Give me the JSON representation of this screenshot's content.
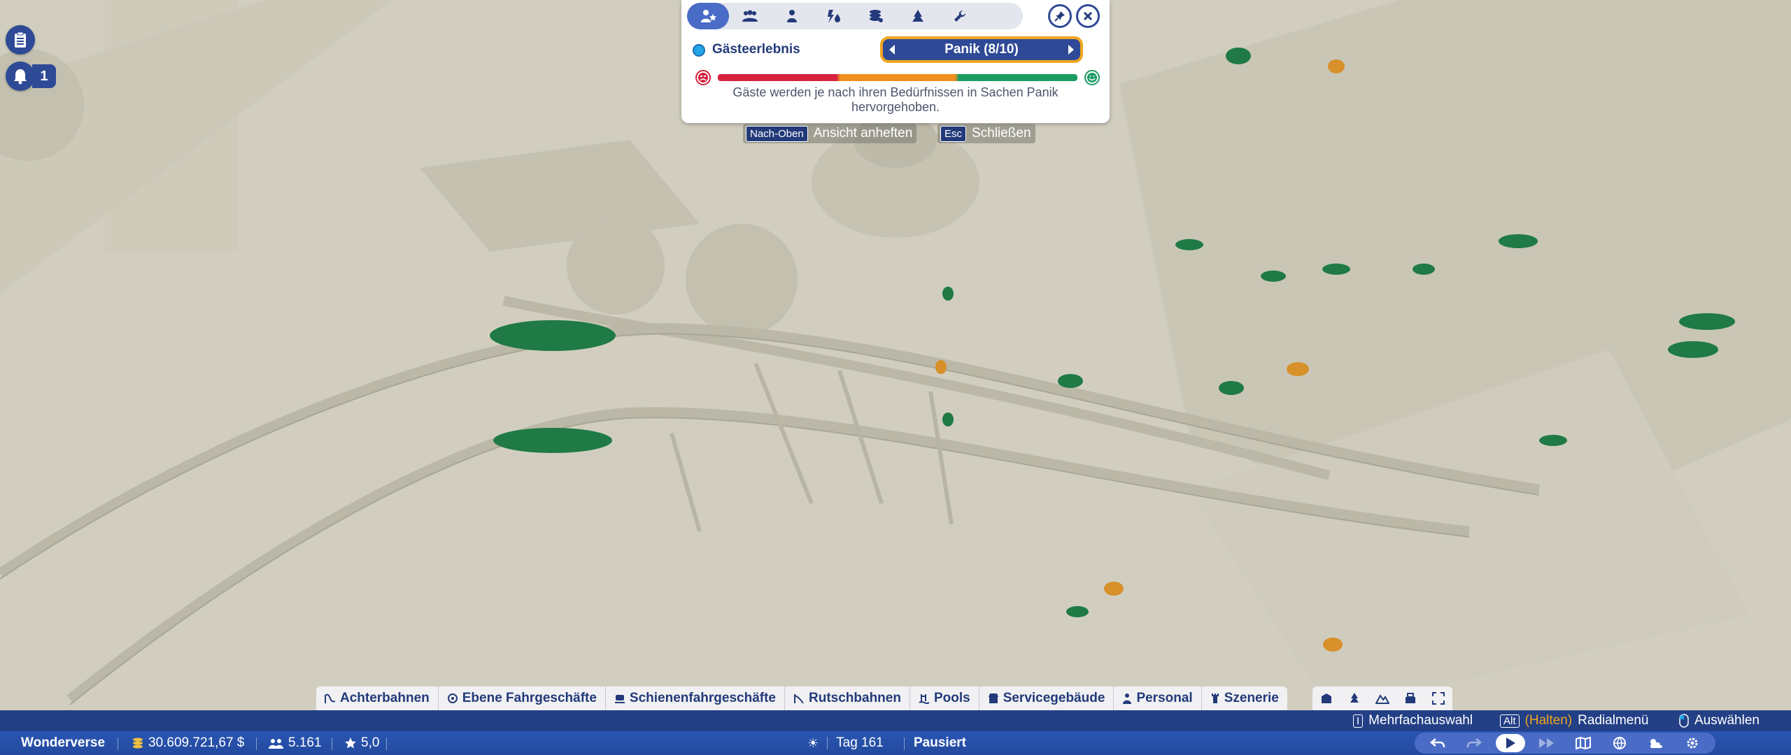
{
  "overlay": {
    "tabs": [
      {
        "name": "guest-experience",
        "icon": "guest-star-icon",
        "active": true
      },
      {
        "name": "groups",
        "icon": "group-icon",
        "active": false
      },
      {
        "name": "guest-single",
        "icon": "person-icon",
        "active": false
      },
      {
        "name": "needs",
        "icon": "drop-bolt-icon",
        "active": false
      },
      {
        "name": "money",
        "icon": "coins-icon",
        "active": false
      },
      {
        "name": "scenery",
        "icon": "tree-icon",
        "active": false
      },
      {
        "name": "maintenance",
        "icon": "wrench-icon",
        "active": false
      }
    ],
    "legend_title": "Gästeerlebnis",
    "selector_value": "Panik (8/10)",
    "description": "Gäste werden je nach ihren Bedürfnissen in Sachen Panik hervorgehoben.",
    "colors": {
      "bad": "#d5233f",
      "mid": "#f08e1e",
      "good": "#1b9b62",
      "accent": "#f0a520"
    }
  },
  "key_hints": {
    "pin_key": "Nach-Oben",
    "pin_label": "Ansicht anheften",
    "close_key": "Esc",
    "close_label": "Schließen"
  },
  "notifications": {
    "count": "1"
  },
  "build_categories": [
    {
      "label": "Achterbahnen",
      "icon": "coaster-icon"
    },
    {
      "label": "Ebene Fahrgeschäfte",
      "icon": "flat-ride-icon"
    },
    {
      "label": "Schienenfahrgeschäfte",
      "icon": "track-ride-icon"
    },
    {
      "label": "Rutschbahnen",
      "icon": "slide-icon"
    },
    {
      "label": "Pools",
      "icon": "pool-icon"
    },
    {
      "label": "Servicegebäude",
      "icon": "shop-icon"
    },
    {
      "label": "Personal",
      "icon": "staff-icon"
    },
    {
      "label": "Szenerie",
      "icon": "tower-icon"
    }
  ],
  "controls": {
    "multi_key": "I",
    "multi_label": "Mehrfachauswahl",
    "radial_key": "Alt",
    "radial_hold": "(Halten)",
    "radial_label": "Radialmenü",
    "select_label": "Auswählen"
  },
  "status": {
    "park_name": "Wonderverse",
    "money": "30.609.721,67 $",
    "guests": "5.161",
    "rating": "5,0",
    "day": "Tag 161",
    "state": "Pausiert"
  }
}
